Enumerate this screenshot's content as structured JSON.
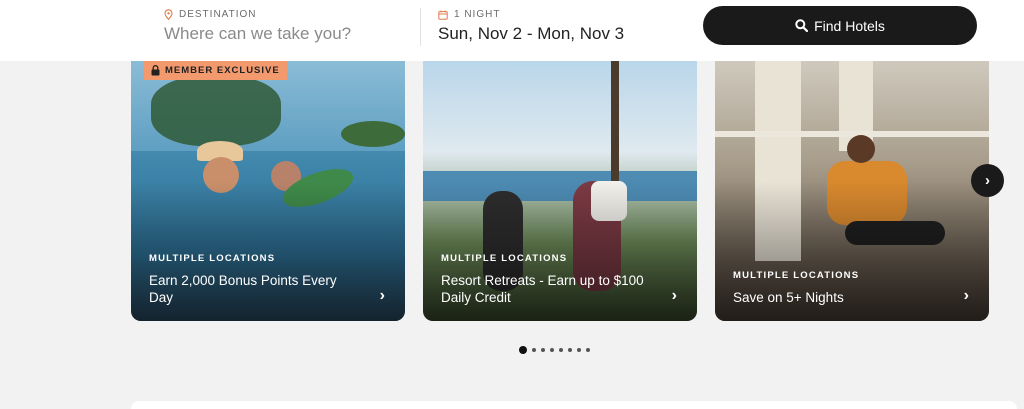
{
  "search": {
    "destination_label": "DESTINATION",
    "destination_placeholder": "Where can we take you?",
    "dates_label": "1 NIGHT",
    "dates_value": "Sun, Nov 2 - Mon, Nov 3",
    "find_label": "Find Hotels"
  },
  "cards": [
    {
      "badge": "MEMBER EXCLUSIVE",
      "location": "MULTIPLE LOCATIONS",
      "title": "Earn 2,000 Bonus Points Every Day"
    },
    {
      "location": "MULTIPLE LOCATIONS",
      "title": "Resort Retreats - Earn up to $100 Daily Credit"
    },
    {
      "location": "MULTIPLE LOCATIONS",
      "title": "Save on 5+ Nights"
    }
  ],
  "carousel": {
    "pages": 8,
    "active": 1
  },
  "icons": {
    "pin": "map-pin-icon",
    "calendar": "calendar-icon",
    "search": "search-icon",
    "lock": "lock-icon",
    "chevron": "chevron-right-icon"
  },
  "colors": {
    "accent": "#f29a6e",
    "button": "#1a1a1a"
  }
}
